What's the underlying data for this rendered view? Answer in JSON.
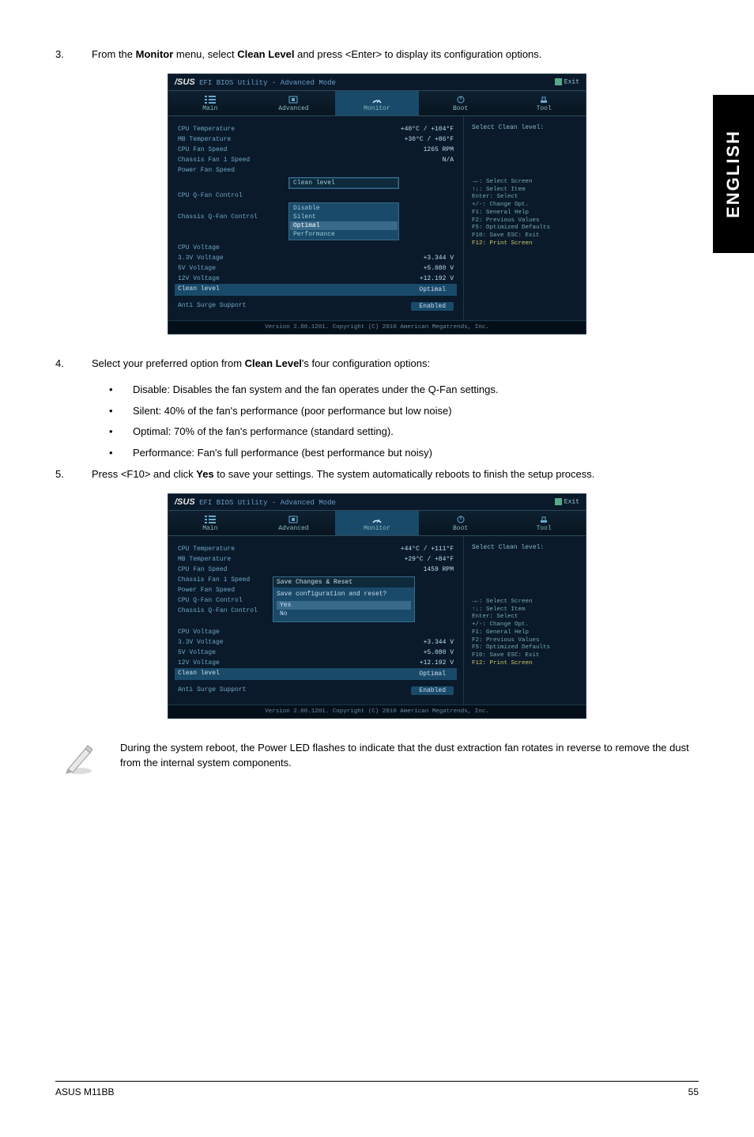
{
  "side_tab": "ENGLISH",
  "step3": {
    "num": "3.",
    "text_a": "From the ",
    "b1": "Monitor",
    "text_b": " menu, select ",
    "b2": "Clean Level",
    "text_c": " and press <Enter> to display its configuration options."
  },
  "step4": {
    "num": "4.",
    "text_a": "Select your preferred option from ",
    "b1": "Clean Level",
    "text_b": "'s four configuration options:"
  },
  "bul": {
    "a": "Disable: Disables the fan system and the fan operates under the Q-Fan settings.",
    "b": "Silent: 40% of the fan's performance (poor performance but low noise)",
    "c": "Optimal: 70% of the fan's performance (standard setting).",
    "d": "Performance: Fan's full performance (best performance but noisy)"
  },
  "step5": {
    "num": "5.",
    "text_a": "Press <F10> and click ",
    "b1": "Yes",
    "text_b": " to save your settings. The system automatically reboots to finish the setup process."
  },
  "note": "During the system reboot, the Power LED flashes to indicate that the dust extraction fan rotates in reverse to remove the dust from the internal system components.",
  "footer_left": "ASUS M11BB",
  "footer_right": "55",
  "bios1": {
    "title_mode": "EFI BIOS Utility - Advanced Mode",
    "exit": "Exit",
    "menu": {
      "main": "Main",
      "adv": "Advanced",
      "mon": "Monitor",
      "boot": "Boot",
      "tool": "Tool"
    },
    "rows": {
      "cpu_t": {
        "l": "CPU Temperature",
        "v": "+40°C / +104°F"
      },
      "mb_t": {
        "l": "MB Temperature",
        "v": "+30°C / +86°F"
      },
      "cpu_fan": {
        "l": "CPU Fan Speed",
        "v": "1265 RPM"
      },
      "ch_fan": {
        "l": "Chassis Fan 1 Speed",
        "v": "N/A"
      },
      "pwr_fan": {
        "l": "Power Fan Speed"
      },
      "cpu_q": {
        "l": "CPU Q-Fan Control"
      },
      "ch_q": {
        "l": "Chassis Q-Fan Control"
      },
      "cpu_v": {
        "l": "CPU Voltage"
      },
      "v33": {
        "l": "3.3V Voltage",
        "v": "+3.344 V"
      },
      "v5": {
        "l": "5V Voltage",
        "v": "+5.080 V"
      },
      "v12": {
        "l": "12V Voltage",
        "v": "+12.192 V"
      },
      "clean": {
        "l": "Clean level",
        "v": "Optimal"
      },
      "anti": {
        "l": "Anti Surge Support",
        "v": "Enabled"
      }
    },
    "drop_label": "Clean level",
    "drop": {
      "a": "Disable",
      "b": "Silent",
      "c": "Optimal",
      "d": "Performance"
    },
    "right_title": "Select Clean level:",
    "hints": {
      "a": "→←: Select Screen",
      "b": "↑↓: Select Item",
      "c": "Enter: Select",
      "d": "+/-: Change Opt.",
      "e": "F1: General Help",
      "f": "F2: Previous Values",
      "g": "F5: Optimized Defaults",
      "h": "F10: Save  ESC: Exit",
      "i": "F12: Print Screen"
    },
    "foot": "Version 2.00.1201. Copyright (C) 2010 American Megatrends, Inc."
  },
  "bios2": {
    "rows": {
      "cpu_t": {
        "l": "CPU Temperature",
        "v": "+44°C / +111°F"
      },
      "mb_t": {
        "l": "MB Temperature",
        "v": "+29°C / +84°F"
      },
      "cpu_fan": {
        "l": "CPU Fan Speed",
        "v": "1459 RPM"
      },
      "ch_fan": {
        "l": "Chassis Fan 1 Speed"
      },
      "pwr_fan": {
        "l": "Power Fan Speed"
      },
      "cpu_q": {
        "l": "CPU Q-Fan Control"
      },
      "ch_q": {
        "l": "Chassis Q-Fan Control"
      },
      "cpu_v": {
        "l": "CPU Voltage"
      },
      "v33": {
        "l": "3.3V Voltage",
        "v": "+3.344 V"
      },
      "v5": {
        "l": "5V Voltage",
        "v": "+5.080 V"
      },
      "v12": {
        "l": "12V Voltage",
        "v": "+12.192 V"
      },
      "clean": {
        "l": "Clean level",
        "v": "Optimal"
      },
      "anti": {
        "l": "Anti Surge Support",
        "v": "Enabled"
      }
    },
    "modal": {
      "title": "Save Changes & Reset",
      "q": "Save configuration and reset?",
      "yes": "Yes",
      "no": "No"
    }
  }
}
